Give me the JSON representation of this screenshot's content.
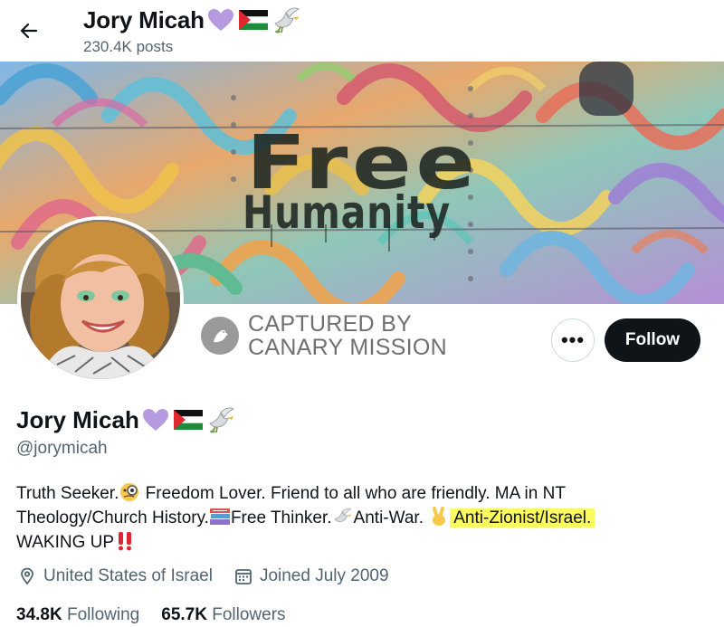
{
  "header": {
    "name": "Jory Micah",
    "posts": "230.4K posts"
  },
  "banner": {
    "line1": "Free",
    "line2": "Humanity"
  },
  "watermark": {
    "line1": "CAPTURED BY",
    "line2": "CANARY MISSION"
  },
  "actions": {
    "more": "•••",
    "follow": "Follow"
  },
  "profile": {
    "name": "Jory Micah",
    "handle": "@jorymicah",
    "bio": {
      "l1a": "Truth Seeker.",
      "l1b": " Freedom Lover. Friend to all who are friendly. MA in NT",
      "l2a": "Theology/Church History.",
      "l2b": "Free Thinker.",
      "l2c": "Anti-War. ",
      "l2d": "Anti-Zionist/Israel.",
      "l3": "WAKING UP"
    },
    "location": "United States of Israel",
    "joined": "Joined July 2009",
    "following_count": "34.8K",
    "following_label": "Following",
    "followers_count": "65.7K",
    "followers_label": "Followers"
  },
  "colors": {
    "text": "#0f1419",
    "muted": "#536471",
    "follow_bg": "#0f1419",
    "highlight": "#fbfb60",
    "heart": "#b59ae0"
  },
  "icons": [
    "back-arrow-icon",
    "purple-heart-icon",
    "palestine-flag-icon",
    "dove-icon",
    "canary-logo-icon",
    "location-pin-icon",
    "calendar-icon",
    "magnifier-eye-icon",
    "books-icon",
    "victory-hand-icon",
    "double-exclamation-icon"
  ]
}
